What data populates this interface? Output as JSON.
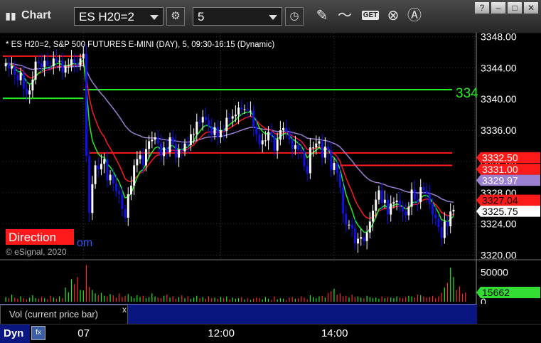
{
  "toolbar": {
    "title": "Chart",
    "symbol": "ES H20=2",
    "interval": "5",
    "get_label": "GET",
    "window_buttons": [
      "?",
      "–",
      "□",
      "✕"
    ]
  },
  "chart_data": {
    "type": "candlestick",
    "title": "* ES H20=2, S&P 500 FUTURES E-MINI (DAY), 5, 09:30-16:15 (Dynamic)",
    "watermark_red": "Direction",
    "watermark_blue": "om",
    "copyright": "© eSignal, 2020",
    "y_ticks": [
      "3348.00",
      "3344.00",
      "3340.00",
      "3336.00",
      "3332.00",
      "3328.00",
      "3324.00",
      "3320.00"
    ],
    "ylim": [
      3319.5,
      3348.5
    ],
    "x_labels": [
      {
        "label": "07",
        "index": 26
      },
      {
        "label": "12:00",
        "index": 72
      },
      {
        "label": "14:00",
        "index": 110
      }
    ],
    "horizontal_levels": [
      {
        "value": 3345.5,
        "color": "#ff1a1a",
        "from": 0,
        "to": 26
      },
      {
        "value": 3340.1,
        "color": "#22ee22",
        "from": 0,
        "to": 26
      },
      {
        "value": 3341.2,
        "color": "#22ee22",
        "from": 26,
        "to": 156
      },
      {
        "value": 3333.1,
        "color": "#ff1a1a",
        "from": 28,
        "to": 156
      },
      {
        "value": 3331.5,
        "color": "#ff1a1a",
        "from": 112,
        "to": 156
      }
    ],
    "right_label_partial": "334",
    "price_tags": [
      {
        "text": "3332.50",
        "bg": "#ff1a1a",
        "fg": "#ffffff",
        "value": 3332.5
      },
      {
        "text": "3331.00",
        "bg": "#ff1a1a",
        "fg": "#ffffff",
        "value": 3331.0
      },
      {
        "text": "3329.97",
        "bg": "#9b7fd0",
        "fg": "#ffffff",
        "value": 3329.97
      },
      {
        "text": "3327.04",
        "bg": "#ff1a1a",
        "fg": "#000000",
        "value": 3327.04
      },
      {
        "text": "3325.75",
        "bg": "#ffffff",
        "fg": "#000000",
        "value": 3325.75
      }
    ],
    "closes": [
      3344.6,
      3343.9,
      3344.2,
      3343.1,
      3342.4,
      3343.4,
      3341.3,
      3340.6,
      3341.1,
      3342.5,
      3344.8,
      3344.6,
      3344.1,
      3344.9,
      3344.3,
      3344.2,
      3345.2,
      3344.8,
      3344.9,
      3343.4,
      3344.3,
      3344.3,
      3345.1,
      3344.6,
      3344.3,
      3345.2,
      3345.8,
      3332.7,
      3325.4,
      3329.1,
      3331.5,
      3331.0,
      3331.7,
      3332.3,
      3329.6,
      3330.3,
      3329.2,
      3328.2,
      3327.8,
      3325.9,
      3324.8,
      3327.8,
      3328.9,
      3331.5,
      3332.3,
      3332.8,
      3331.5,
      3333.6,
      3334.6,
      3334.8,
      3335.1,
      3334.3,
      3332.7,
      3333.8,
      3333.2,
      3335.1,
      3334.3,
      3332.5,
      3333.5,
      3333.3,
      3334.3,
      3334.1,
      3335.5,
      3335.5,
      3337.1,
      3337.0,
      3337.7,
      3337.3,
      3336.5,
      3335.4,
      3336.4,
      3335.1,
      3336.0,
      3335.9,
      3337.6,
      3337.5,
      3337.8,
      3338.0,
      3338.9,
      3338.7,
      3338.7,
      3338.5,
      3338.5,
      3336.5,
      3335.5,
      3334.2,
      3334.7,
      3334.7,
      3335.8,
      3335.3,
      3333.4,
      3334.8,
      3336.0,
      3336.3,
      3335.8,
      3334.8,
      3333.6,
      3334.1,
      3333.5,
      3333.3,
      3331.4,
      3330.5,
      3333.8,
      3333.8,
      3334.3,
      3334.6,
      3332.5,
      3333.9,
      3333.4,
      3330.9,
      3331.8,
      3330.5,
      3328.7,
      3325.3,
      3323.9,
      3323.9,
      3323.4,
      3321.5,
      3322.1,
      3322.3,
      3321.8,
      3322.9,
      3324.3,
      3325.7,
      3327.1,
      3328.3,
      3326.7,
      3327.1,
      3325.2,
      3326.6,
      3326.8,
      3327.0,
      3326.2,
      3325.6,
      3325.1,
      3326.2,
      3328.4,
      3327.1,
      3326.8,
      3328.7,
      3328.3,
      3327.8,
      3326.6,
      3325.2,
      3324.7,
      3323.6,
      3322.2,
      3324.3,
      3323.7,
      3325.6,
      3325.8
    ],
    "volume_ticks": [
      "50000",
      "0"
    ],
    "volume_max": 70000,
    "volume_label": "15662",
    "volume_value": 15662,
    "volume_series": [
      8000,
      6000,
      12000,
      7000,
      5000,
      9000,
      6000,
      4000,
      7000,
      11000,
      6000,
      5000,
      8000,
      6000,
      4000,
      10000,
      7000,
      5000,
      9000,
      6000,
      24000,
      16000,
      38000,
      30000,
      42000,
      20000,
      19000,
      62000,
      25000,
      20000,
      14000,
      11000,
      15000,
      10000,
      9000,
      13000,
      11000,
      7000,
      14000,
      8000,
      10000,
      13000,
      9000,
      6000,
      11000,
      8000,
      10000,
      6000,
      8000,
      14000,
      9000,
      7000,
      6000,
      10000,
      12000,
      7000,
      9000,
      5000,
      8000,
      11000,
      6000,
      9000,
      5000,
      7000,
      10000,
      6000,
      8000,
      5000,
      9000,
      6000,
      7000,
      5000,
      8000,
      6000,
      9000,
      4000,
      7000,
      5000,
      6000,
      8000,
      4000,
      6000,
      3000,
      5000,
      7000,
      6000,
      4000,
      8000,
      5000,
      3000,
      9000,
      4000,
      6000,
      5000,
      3000,
      7000,
      8000,
      5000,
      6000,
      9000,
      7000,
      4000,
      11000,
      8000,
      6000,
      9000,
      10000,
      7000,
      15000,
      18000,
      22000,
      12000,
      14000,
      9000,
      10000,
      7000,
      12000,
      8000,
      9000,
      7000,
      6000,
      10000,
      8000,
      6000,
      7000,
      5000,
      9000,
      6000,
      8000,
      7000,
      6000,
      9000,
      7000,
      6000,
      8000,
      10000,
      9000,
      7000,
      12000,
      11000,
      9000,
      7000,
      8000,
      10000,
      6000,
      9000,
      15000,
      24000,
      32000,
      58000,
      42000,
      20000,
      26000,
      14000,
      15662
    ],
    "legend_label": "Vol (current price bar)",
    "legend_close": "x"
  },
  "bottom": {
    "dyn": "Dyn",
    "fx": "fx"
  },
  "colors": {
    "up_candle": "#ffffff",
    "down_candle": "#1010e8",
    "ma_red": "#ff1a1a",
    "ma_green": "#22ee22",
    "ma_purple": "#9b7fd0",
    "volume_up": "#22ee22",
    "volume_down": "#ff2a2a"
  }
}
